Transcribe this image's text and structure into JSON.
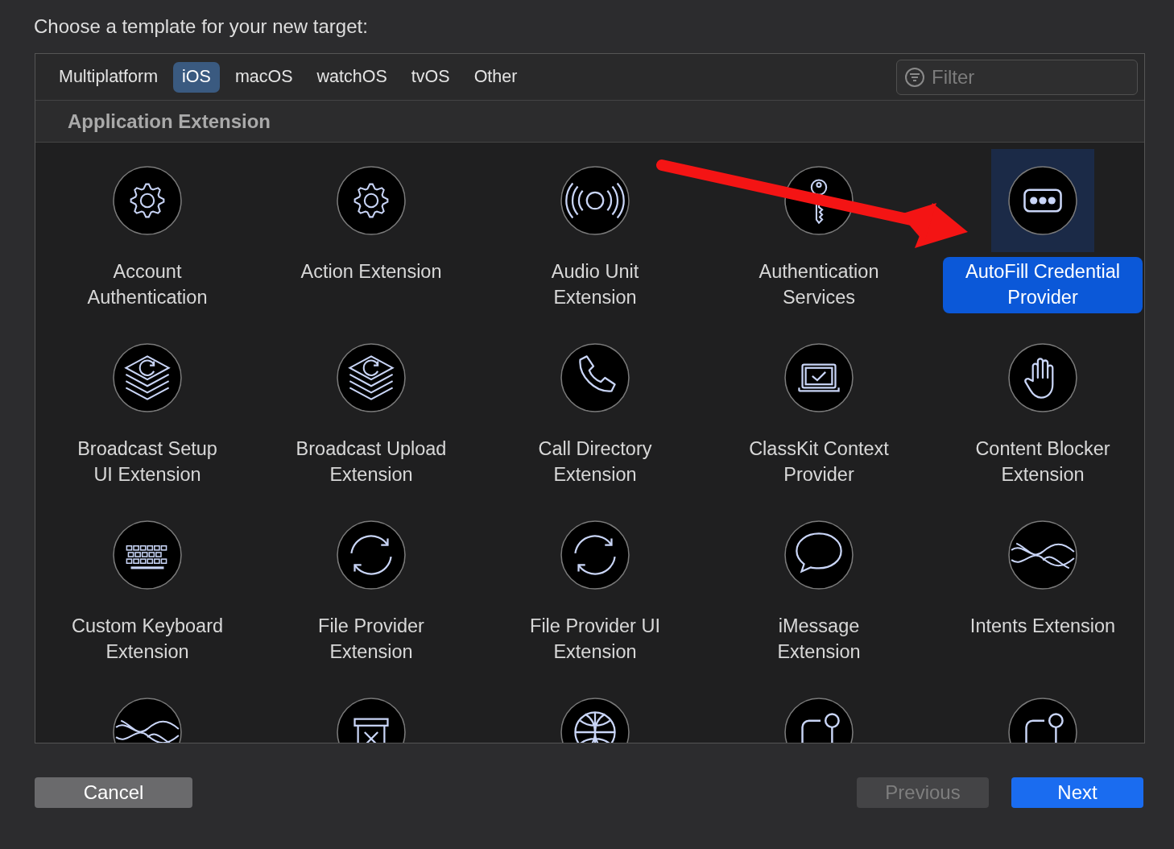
{
  "dialog": {
    "prompt": "Choose a template for your new target:"
  },
  "tabs": [
    {
      "label": "Multiplatform",
      "selected": false
    },
    {
      "label": "iOS",
      "selected": true
    },
    {
      "label": "macOS",
      "selected": false
    },
    {
      "label": "watchOS",
      "selected": false
    },
    {
      "label": "tvOS",
      "selected": false
    },
    {
      "label": "Other",
      "selected": false
    }
  ],
  "filter": {
    "placeholder": "Filter"
  },
  "section": {
    "title": "Application Extension"
  },
  "templates": [
    {
      "name": "Account Authentication",
      "kind": "gear",
      "selected": false
    },
    {
      "name": "Action Extension",
      "kind": "gear",
      "selected": false
    },
    {
      "name": "Audio Unit Extension",
      "kind": "audio",
      "selected": false
    },
    {
      "name": "Authentication Services",
      "kind": "key",
      "selected": false
    },
    {
      "name": "AutoFill Credential Provider",
      "kind": "dots",
      "selected": true
    },
    {
      "name": "Broadcast Setup UI Extension",
      "kind": "layers",
      "selected": false
    },
    {
      "name": "Broadcast Upload Extension",
      "kind": "layers",
      "selected": false
    },
    {
      "name": "Call Directory Extension",
      "kind": "phone",
      "selected": false
    },
    {
      "name": "ClassKit Context Provider",
      "kind": "screen",
      "selected": false
    },
    {
      "name": "Content Blocker Extension",
      "kind": "hand",
      "selected": false
    },
    {
      "name": "Custom Keyboard Extension",
      "kind": "keyboard",
      "selected": false
    },
    {
      "name": "File Provider Extension",
      "kind": "sync",
      "selected": false
    },
    {
      "name": "File Provider UI Extension",
      "kind": "sync",
      "selected": false
    },
    {
      "name": "iMessage Extension",
      "kind": "bubble",
      "selected": false
    },
    {
      "name": "Intents Extension",
      "kind": "waves",
      "selected": false
    },
    {
      "kind": "waves",
      "selected": false
    },
    {
      "kind": "trash",
      "selected": false
    },
    {
      "kind": "globe",
      "selected": false
    },
    {
      "kind": "corner",
      "selected": false
    },
    {
      "kind": "corner",
      "selected": false
    }
  ],
  "buttons": [
    {
      "label": "Cancel",
      "kind": "secondary",
      "disabled": false
    },
    {
      "label": "Previous",
      "kind": "secondary",
      "disabled": true
    },
    {
      "label": "Next",
      "kind": "primary",
      "disabled": false
    }
  ]
}
